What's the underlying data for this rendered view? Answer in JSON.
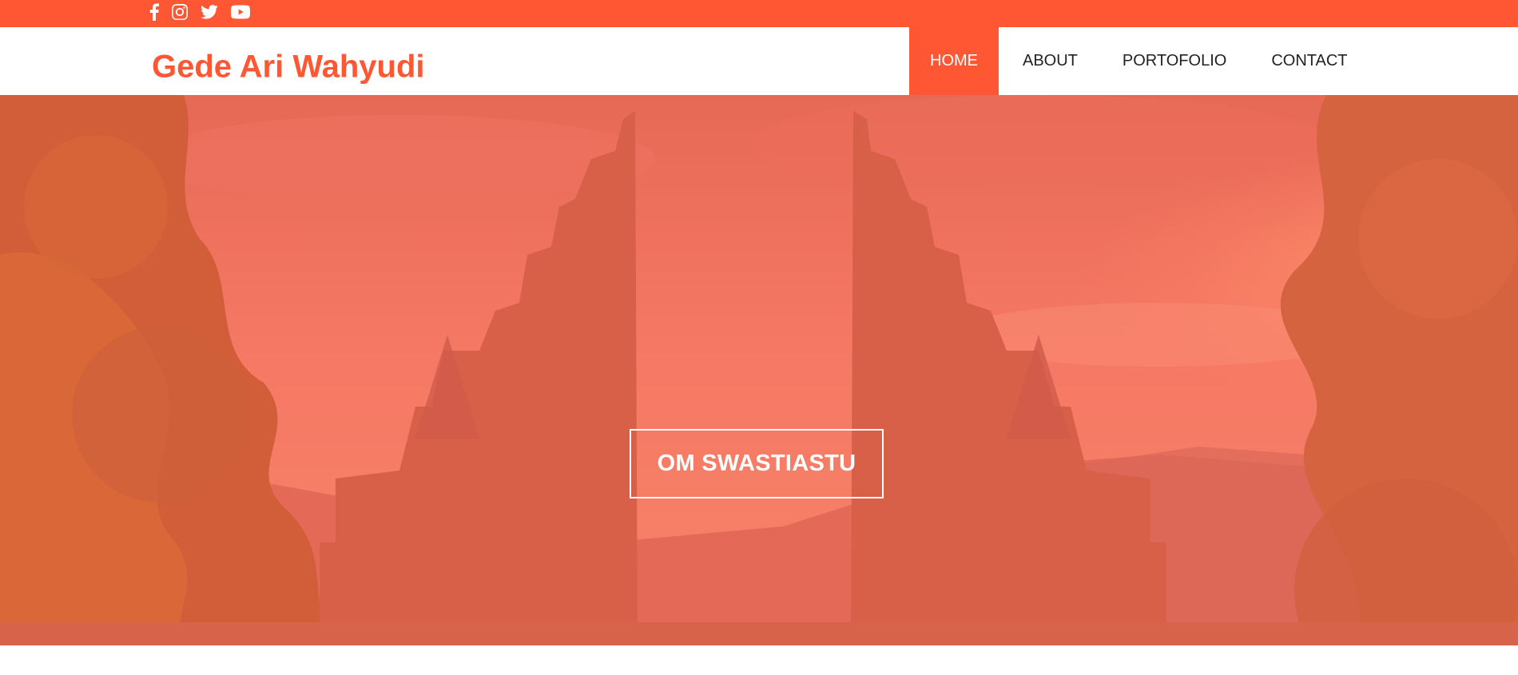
{
  "social": {
    "icons": [
      "facebook-icon",
      "instagram-icon",
      "twitter-icon",
      "youtube-icon"
    ]
  },
  "brand": {
    "name": "Gede Ari Wahyudi"
  },
  "nav": {
    "items": [
      {
        "label": "HOME",
        "active": true
      },
      {
        "label": "ABOUT",
        "active": false
      },
      {
        "label": "PORTOFOLIO",
        "active": false
      },
      {
        "label": "CONTACT",
        "active": false
      }
    ]
  },
  "hero": {
    "button_label": "OM SWASTIASTU"
  },
  "colors": {
    "accent": "#ff5733",
    "nav_text": "#222222",
    "hero_overlay": "#ff6a4d"
  }
}
